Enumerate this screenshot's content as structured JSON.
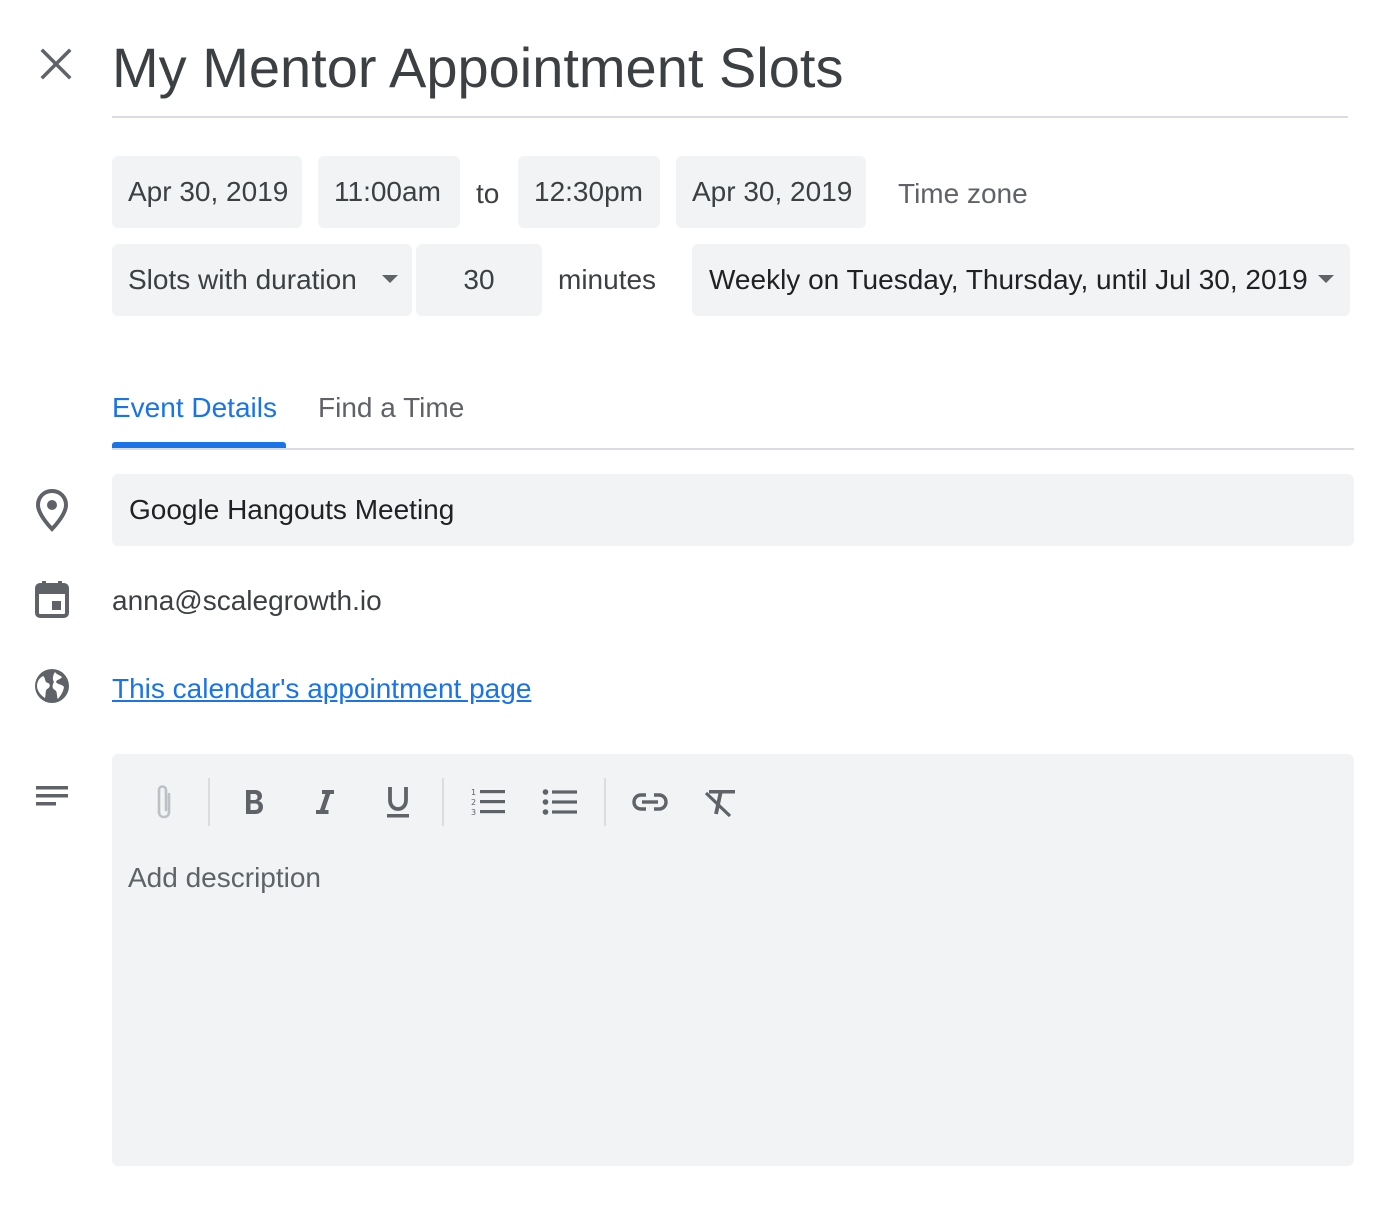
{
  "title": "My Mentor Appointment Slots",
  "datetime": {
    "start_date": "Apr 30, 2019",
    "start_time": "11:00am",
    "to_label": "to",
    "end_time": "12:30pm",
    "end_date": "Apr 30, 2019",
    "timezone_label": "Time zone"
  },
  "slots": {
    "mode": "Slots with duration",
    "duration": "30",
    "unit": "minutes",
    "recurrence": "Weekly on Tuesday, Thursday, until Jul 30, 2019"
  },
  "tabs": [
    {
      "label": "Event Details",
      "active": true
    },
    {
      "label": "Find a Time",
      "active": false
    }
  ],
  "location": "Google Hangouts Meeting",
  "calendar": "anna@scalegrowth.io",
  "appointment_link": "This calendar's appointment page",
  "description": {
    "placeholder": "Add description",
    "toolbar": [
      "attachment-icon",
      "bold-icon",
      "italic-icon",
      "underline-icon",
      "numbered-list-icon",
      "bulleted-list-icon",
      "link-icon",
      "clear-formatting-icon"
    ]
  },
  "colors": {
    "accent": "#1a73e8",
    "field_bg": "#f1f3f4",
    "text": "#3c4043",
    "muted": "#5f6368"
  }
}
